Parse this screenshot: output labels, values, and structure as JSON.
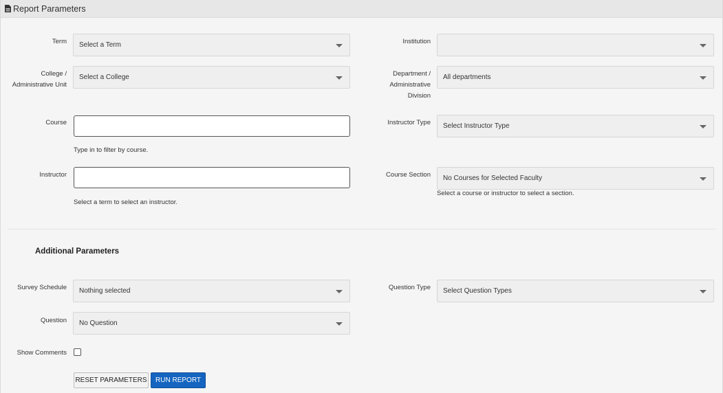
{
  "header": {
    "title": "Report Parameters",
    "icon": "document-icon"
  },
  "fields": {
    "term": {
      "label": "Term",
      "value": "Select a Term"
    },
    "institution": {
      "label": "Institution",
      "value": ""
    },
    "college": {
      "label_line1": "College /",
      "label_line2": "Administrative Unit",
      "value": "Select a College"
    },
    "department": {
      "label_line1": "Department /",
      "label_line2": "Administrative",
      "label_line3": "Division",
      "value": "All departments"
    },
    "course": {
      "label": "Course",
      "value": "",
      "help": "Type in to filter by course."
    },
    "instructor_type": {
      "label": "Instructor Type",
      "value": "Select Instructor Type"
    },
    "instructor": {
      "label": "Instructor",
      "value": "",
      "help": "Select a term to select an instructor."
    },
    "course_section": {
      "label": "Course Section",
      "value": "No Courses for Selected Faculty",
      "help": "Select a course or instructor to select a section."
    }
  },
  "additional": {
    "title": "Additional Parameters",
    "survey_schedule": {
      "label": "Survey Schedule",
      "value": "Nothing selected"
    },
    "question_type": {
      "label": "Question Type",
      "value": "Select Question Types"
    },
    "question": {
      "label": "Question",
      "value": "No Question"
    },
    "show_comments": {
      "label": "Show Comments",
      "checked": false
    }
  },
  "buttons": {
    "reset": "RESET PARAMETERS",
    "run": "RUN REPORT"
  },
  "colors": {
    "primary": "#1565c0",
    "panel_bg": "#f5f5f5",
    "header_bg": "#e7e7e7"
  }
}
